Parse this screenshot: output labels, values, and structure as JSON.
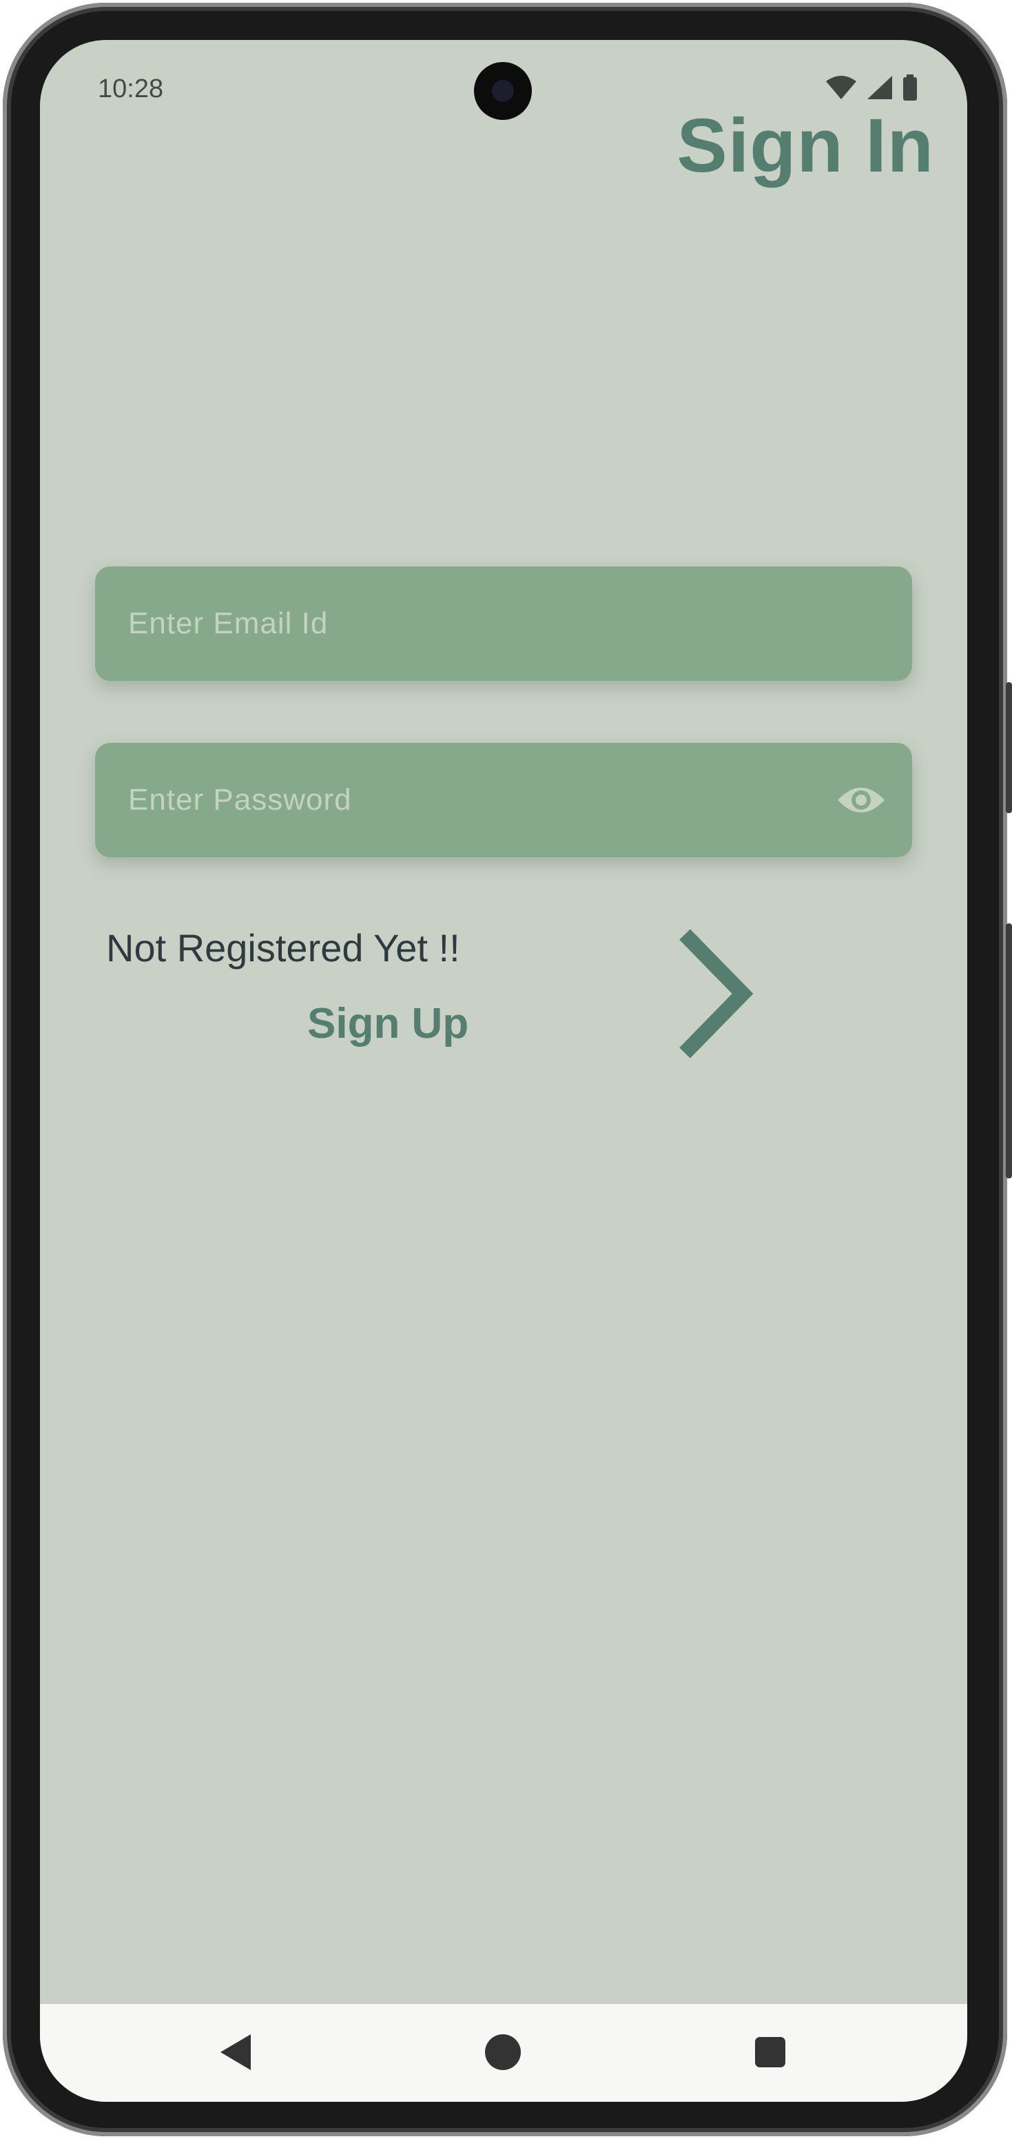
{
  "status_bar": {
    "time": "10:28",
    "icons": [
      "wifi-icon",
      "cell-signal-icon",
      "battery-icon"
    ]
  },
  "header": {
    "title": "Sign In"
  },
  "form": {
    "email_placeholder": "Enter Email Id",
    "password_placeholder": "Enter Password",
    "password_visibility_icon": "eye-icon"
  },
  "signup": {
    "prompt": "Not Registered Yet !!",
    "link_label": "Sign Up",
    "arrow_icon": "chevron-right-icon"
  },
  "nav_bar": {
    "buttons": [
      "back-icon",
      "home-icon",
      "recents-icon"
    ]
  },
  "colors": {
    "background": "#c9d1c6",
    "accent": "#557d70",
    "field": "#86a98c",
    "placeholder": "#c4d2c0",
    "text_dark": "#2e3a3f"
  }
}
